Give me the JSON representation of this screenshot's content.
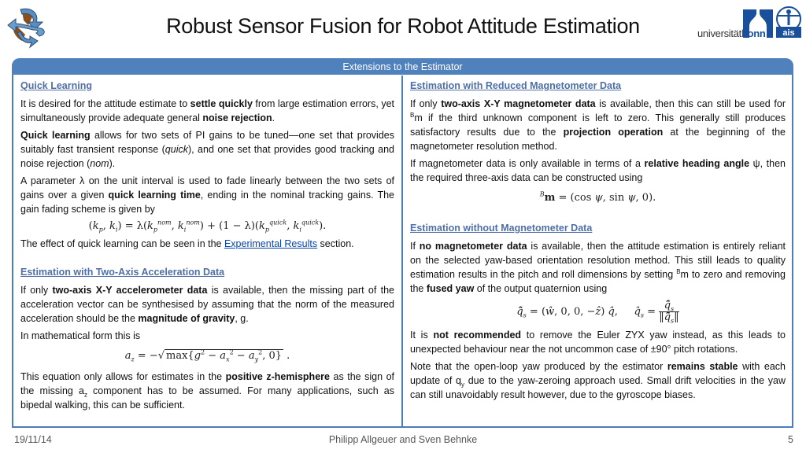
{
  "header": {
    "title": "Robust Sensor Fusion for Robot Attitude Estimation",
    "logo_left": "ribbon-arrows-logo",
    "logo_right_text_light": "universität",
    "logo_right_text_bold": "bonn",
    "logo_right_badge": "ais"
  },
  "panel": {
    "title": "Extensions to the Estimator"
  },
  "left": {
    "quick_learning": {
      "title": "Quick Learning",
      "p1": [
        "It is desired for the attitude estimate to ",
        "settle quickly",
        " from large estimation errors, yet simultaneously provide adequate general ",
        "noise rejection",
        "."
      ],
      "p2": [
        "Quick learning",
        " allows for two sets of PI gains to be tuned—one set that provides suitably fast transient response (",
        "quick",
        "), and one set that provides good tracking and noise rejection (",
        "nom",
        ")."
      ],
      "p3": [
        "A parameter λ on the unit interval is used to fade linearly between the two sets of gains over a given ",
        "quick learning time",
        ", ending in the nominal tracking gains. The gain fading scheme is given by"
      ],
      "equation": "(kp, ki) = λ(kp^nom, ki^nom) + (1 − λ)(kp^quick, ki^quick).",
      "p4_before": "The effect of quick learning can be seen in the ",
      "p4_link": "Experimental Results",
      "p4_after": " section."
    },
    "two_axis_accel": {
      "title": "Estimation with Two-Axis Acceleration Data",
      "p1": [
        "If only ",
        "two-axis X-Y accelerometer data",
        " is available, then the missing part of the acceleration vector can be synthesised by assuming that the norm of the measured acceleration should be the ",
        "magnitude of gravity",
        ", g."
      ],
      "p2": "In mathematical form this is",
      "equation": "az = −√(max{g² − ax² − ay², 0}).",
      "p3": [
        "This equation only allows for estimates in the ",
        "positive z-hemisphere",
        " as the sign of the missing a",
        "z",
        " component has to be assumed. For many applications, such as bipedal walking, this can be sufficient."
      ]
    }
  },
  "right": {
    "reduced_mag": {
      "title": "Estimation with Reduced Magnetometer Data",
      "p1": [
        "If only ",
        "two-axis X-Y magnetometer data",
        " is available, then this can still be used for ",
        "B",
        "m if the third unknown component is left to zero. This generally still produces satisfactory results due to the ",
        "projection operation",
        " at the beginning of the magnetometer resolution method."
      ],
      "p2": [
        "If magnetometer data is only available in terms of a ",
        "relative heading angle",
        " ψ, then the required three-axis data can be constructed using"
      ],
      "equation": "Bm = (cos ψ, sin ψ, 0)."
    },
    "no_mag": {
      "title": "Estimation without Magnetometer Data",
      "p1": [
        "If ",
        "no magnetometer data",
        " is available, then the attitude estimation is entirely reliant on the selected yaw-based orientation resolution method. This still leads to quality estimation results in the pitch and roll dimensions by setting ",
        "B",
        "m to zero and removing the ",
        "fused yaw",
        " of the output quaternion using"
      ],
      "equation_1": "q̃̂s = (ŵ, 0, 0, −ẑ) q̂,",
      "equation_2": "q̂s = q̃̂s / ‖q̃̂s‖",
      "p2": [
        "It is ",
        "not recommended",
        " to remove the Euler ZYX yaw instead, as this leads to unexpected behaviour near the not uncommon case of ±90° pitch rotations."
      ],
      "p3": [
        "Note that the open-loop yaw produced by the estimator ",
        "remains stable",
        " with each update of q",
        "y",
        " due to the yaw-zeroing approach used. Small drift velocities in the yaw can still unavoidably result however, due to the gyroscope biases."
      ]
    }
  },
  "footer": {
    "date": "19/11/14",
    "authors": "Philipp Allgeuer and Sven Behnke",
    "page": "5"
  },
  "colors": {
    "accent": "#4f81bd",
    "section_title": "#4f6fa8",
    "link": "#0645ad"
  }
}
